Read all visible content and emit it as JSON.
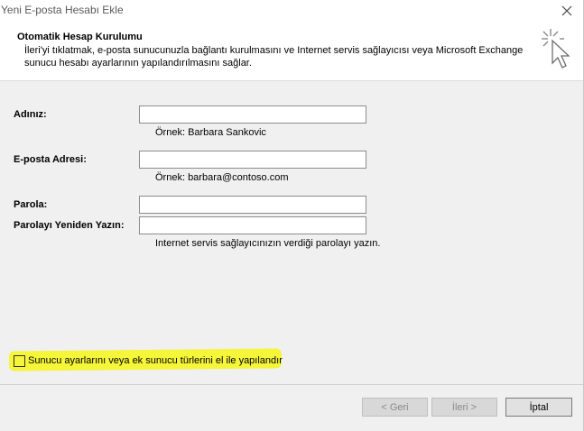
{
  "window": {
    "title": "Yeni E-posta Hesabı Ekle",
    "close_icon": "close-icon"
  },
  "header": {
    "title": "Otomatik Hesap Kurulumu",
    "description": "İleri'yi tıklatmak, e-posta sunucunuzla bağlantı kurulmasını ve Internet servis sağlayıcısı veya Microsoft Exchange sunucu hesabı ayarlarının yapılandırılmasını sağlar.",
    "icon": "wizard-cursor-icon"
  },
  "form": {
    "name": {
      "label": "Adınız:",
      "value": "",
      "hint": "Örnek: Barbara Sankovic"
    },
    "email": {
      "label": "E-posta Adresi:",
      "value": "",
      "hint": "Örnek: barbara@contoso.com"
    },
    "password": {
      "label": "Parola:",
      "value": ""
    },
    "password_confirm": {
      "label": "Parolayı Yeniden Yazın:",
      "value": "",
      "hint": "Internet servis sağlayıcınızın verdiği parolayı yazın."
    }
  },
  "manual_setup": {
    "label": "Sunucu ayarlarını veya ek sunucu türlerini el ile yapılandır",
    "checked": false,
    "highlight_color": "#f5f53a"
  },
  "buttons": {
    "back": "< Geri",
    "next": "İleri >",
    "cancel": "İptal"
  }
}
